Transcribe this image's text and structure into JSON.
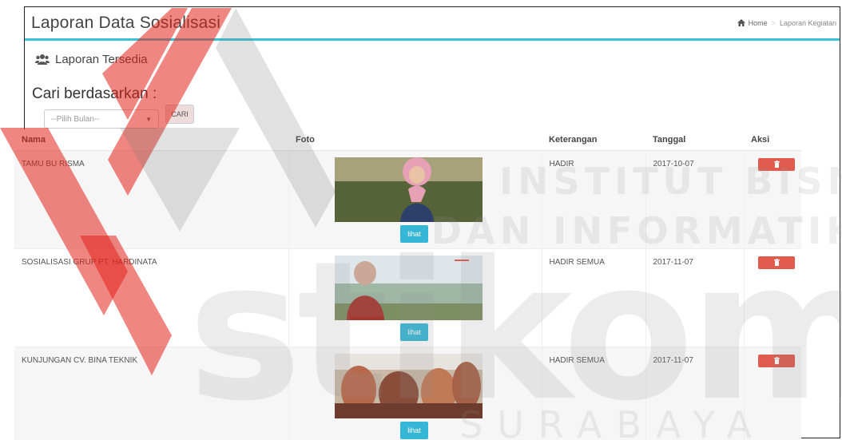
{
  "header": {
    "title": "Laporan Data Sosialisasi"
  },
  "breadcrumb": {
    "home": "Home",
    "current": "Laporan Kegiatan"
  },
  "panel": {
    "title": "Laporan Tersedia"
  },
  "search": {
    "label": "Cari berdasarkan :",
    "month_select": "--Pilih Bulan--",
    "button": "CARI"
  },
  "table": {
    "columns": [
      "Nama",
      "Foto",
      "Keterangan",
      "Tanggal",
      "Aksi"
    ],
    "rows": [
      {
        "nama": "TAMU BU RISMA",
        "keterangan": "HADIR",
        "tanggal": "2017-10-07",
        "lihat": "lihat"
      },
      {
        "nama": "SOSIALISASI GRUP PT. HARDINATA",
        "keterangan": "HADIR SEMUA",
        "tanggal": "2017-11-07",
        "lihat": "lihat"
      },
      {
        "nama": "KUNJUNGAN CV. BINA TEKNIK",
        "keterangan": "HADIR SEMUA",
        "tanggal": "2017-11-07",
        "lihat": "lihat"
      }
    ]
  },
  "watermark": {
    "line1": "INSTITUT BISNIS",
    "line2": "DAN INFORMATIKA",
    "logo": "stikom",
    "city": "SURABAYA"
  },
  "colors": {
    "accent": "#3cc3d8",
    "lihat_button": "#37b7d6",
    "delete_button": "#e05a4e",
    "logo_red": "#e2231a"
  }
}
